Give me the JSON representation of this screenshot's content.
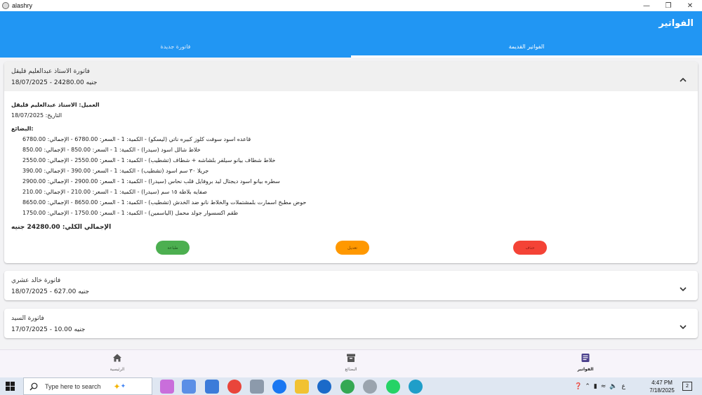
{
  "window": {
    "title": "alashry"
  },
  "header": {
    "title": "الفواتير"
  },
  "tabs": [
    {
      "label": "فاتورة جديدة",
      "active": false
    },
    {
      "label": "الفواتير القديمة",
      "active": true
    }
  ],
  "invoices": [
    {
      "title": "فاتورة الاستاذ عبدالعليم قليقل",
      "subtitle": "18/07/2025 - 24280.00 جنيه",
      "expanded": true,
      "client_line": "العميل: الاستاذ عبدالعليم قليقل",
      "date_line": "التاريخ: 18/07/2025",
      "goods_label": "البضائع:",
      "items": [
        "قاعده اسود سوفت كلوز كبيره ناتي (ليسكو) - الكمية: 1 - السعر: 6780.00 - الإجمالي: 6780.00",
        "خلاط شالل اسود (سيدرا) - الكمية: 1 - السعر: 850.00 - الإجمالي: 850.00",
        "خلاط شطاف بيانو سيلفر بلشاشه + شطاف (تشطيب) - الكمية: 1 - السعر: 2550.00 - الإجمالي: 2550.00",
        "جريلا ٣٠ سم اسود (تشطيب) - الكمية: 1 - السعر: 390.00 - الإجمالي: 390.00",
        "سطره بيانو اسود ديجتال ليد بروفايل قلب نحاس (سيدرا) - الكمية: 1 - السعر: 2900.00 - الإجمالي: 2900.00",
        "صفايه بلاطه ١٥ سم (سيدرا) - الكمية: 1 - السعر: 210.00 - الإجمالي: 210.00",
        "حوض مطبخ اسمارت بلمشتملات والخلاط نانو ضد الخدش (تشطيب) - الكمية: 1 - السعر: 8650.00 - الإجمالي: 8650.00",
        "طقم اكسسوار جولد محمل (الياسمين) - الكمية: 1 - السعر: 1750.00 - الإجمالي: 1750.00"
      ],
      "total_line": "الإجمالي الكلي: 24280.00 جنيه",
      "buttons": {
        "delete": "حذف",
        "edit": "تعديل",
        "print": "طباعة"
      }
    },
    {
      "title": "فاتورة خالد عشري",
      "subtitle": "18/07/2025 - 627.00 جنيه",
      "expanded": false
    },
    {
      "title": "فاتورة السيد",
      "subtitle": "17/07/2025 - 10.00 جنيه",
      "expanded": false
    }
  ],
  "bottom_nav": [
    {
      "label": "الفواتير",
      "icon": "receipt-icon",
      "active": true
    },
    {
      "label": "البضائع",
      "icon": "archive-icon",
      "active": false
    },
    {
      "label": "الرئيسية",
      "icon": "home-icon",
      "active": false
    }
  ],
  "taskbar": {
    "search_placeholder": "Type here to search",
    "time": "4:47 PM",
    "date": "7/18/2025",
    "lang": "ع",
    "notification_count": "2"
  },
  "colors": {
    "primary": "#2196f3",
    "print_button": "#4caf50",
    "edit_button": "#ff9800",
    "delete_button": "#f44336"
  }
}
